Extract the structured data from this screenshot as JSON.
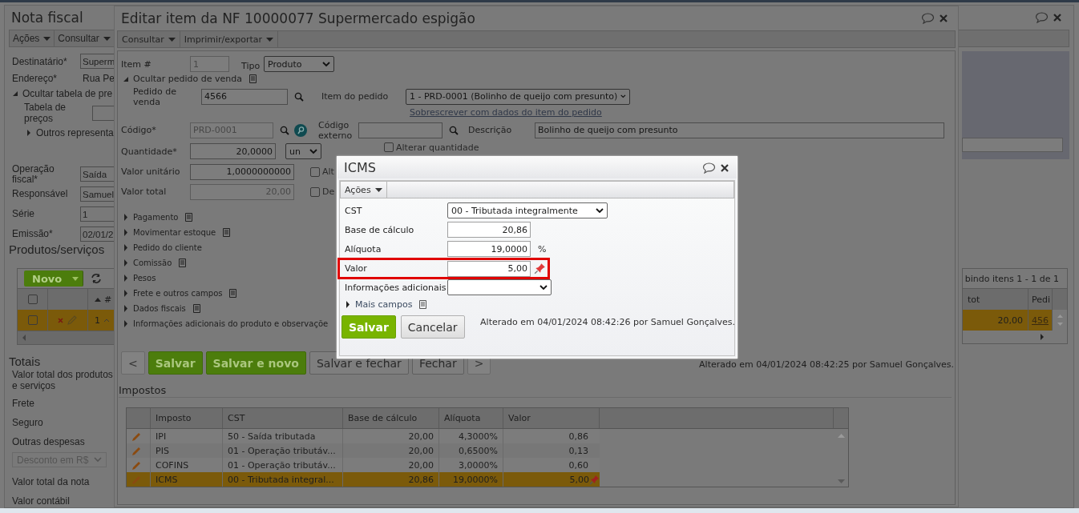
{
  "main_window": {
    "title": "Nota fiscal",
    "toolbar": [
      "Ações",
      "Consultar"
    ],
    "recipient": {
      "label": "Destinatário*",
      "value": "Superm"
    },
    "address": {
      "label": "Endereço*",
      "value": "Rua Pe"
    },
    "price_toggle": {
      "label": "Ocultar tabela de pre",
      "expanded": true
    },
    "price_table": {
      "label": "Tabela de preços"
    },
    "reps_toggle": {
      "label": "Outros representa",
      "expanded": false
    },
    "fields": [
      {
        "label": "Operação fiscal*",
        "value": "Saída"
      },
      {
        "label": "Responsável",
        "value": "Samuel"
      },
      {
        "label": "Série",
        "value": "1"
      },
      {
        "label": "Emissão*",
        "value": "02/01/2"
      }
    ],
    "products": {
      "title": "Produtos/serviços",
      "new_button": "Novo",
      "pager": "bindo itens 1 - 1 de 1",
      "header_checked": false,
      "columns": [
        "#",
        "tot",
        "Pedi"
      ],
      "rows": [
        {
          "number": "1",
          "total": "20,00",
          "order": "456",
          "selected": true,
          "checked": false
        }
      ]
    },
    "totals": {
      "title": "Totais",
      "rows": [
        {
          "kind": "label",
          "text": "Valor total dos produtos e serviços"
        },
        {
          "kind": "label",
          "text": "Frete"
        },
        {
          "kind": "label",
          "text": "Seguro"
        },
        {
          "kind": "label",
          "text": "Outras despesas"
        },
        {
          "kind": "select",
          "text": "Desconto em R$"
        },
        {
          "kind": "label",
          "text": "Valor total da nota"
        },
        {
          "kind": "label",
          "text": "Valor contábil"
        }
      ]
    }
  },
  "item_window": {
    "title": "Editar item da NF 10000077 Supermercado espigão",
    "toolbar": [
      "Consultar",
      "Imprimir/exportar"
    ],
    "item_number": {
      "label": "Item #",
      "value": "1",
      "disabled": true
    },
    "type": {
      "label": "Tipo",
      "value": "Produto"
    },
    "order_toggle": {
      "label": "Ocultar pedido de venda",
      "expanded": true
    },
    "sales_order": {
      "label": "Pedido de venda",
      "value": "4566"
    },
    "order_item": {
      "label": "Item do pedido",
      "value": "1 - PRD-0001 (Bolinho de queijo com presunto)"
    },
    "overwrite_link": "Sobrescrever com dados do item do pedido",
    "code": {
      "label": "Código*",
      "value": "PRD-0001",
      "disabled": true
    },
    "external_code": {
      "label": "Código externo"
    },
    "description": {
      "label": "Descrição",
      "value": "Bolinho de queijo com presunto"
    },
    "quantity": {
      "label": "Quantidade*",
      "value": "20,0000",
      "unit": "un",
      "option": {
        "label": "Alterar quantidade",
        "checked": false
      }
    },
    "unit_price": {
      "label": "Valor unitário",
      "value": "1,0000000000",
      "option": {
        "label": "Alt",
        "checked": false
      }
    },
    "total": {
      "label": "Valor total",
      "value": "20,00",
      "disabled": true,
      "option": {
        "label": "De",
        "checked": false
      }
    },
    "sections": [
      {
        "label": "Pagamento",
        "help": true,
        "expanded": false
      },
      {
        "label": "Movimentar estoque",
        "help": true,
        "expanded": false
      },
      {
        "label": "Pedido do cliente",
        "help": false,
        "expanded": false
      },
      {
        "label": "Comissão",
        "help": true,
        "expanded": false
      },
      {
        "label": "Pesos",
        "help": false,
        "expanded": false
      },
      {
        "label": "Frete e outros campos",
        "help": true,
        "expanded": false
      },
      {
        "label": "Dados fiscais",
        "help": true,
        "expanded": false
      },
      {
        "label": "Informações adicionais do produto e observaçõe",
        "help": false,
        "expanded": false
      }
    ],
    "buttons": [
      {
        "label": "<",
        "kind": "nav",
        "disabled": true
      },
      {
        "label": "Salvar",
        "kind": "primary",
        "disabled": false
      },
      {
        "label": "Salvar e novo",
        "kind": "primary",
        "disabled": false
      },
      {
        "label": "Salvar e fechar",
        "kind": "default",
        "disabled": false
      },
      {
        "label": "Fechar",
        "kind": "default",
        "disabled": false
      },
      {
        "label": ">",
        "kind": "nav",
        "disabled": true
      }
    ],
    "audit": "Alterado em 04/01/2024 08:42:25 por Samuel Gonçalves.",
    "taxes": {
      "title": "Impostos",
      "columns": [
        "Imposto",
        "CST",
        "Base de cálculo",
        "Alíquota",
        "Valor"
      ],
      "rows": [
        {
          "tax": "IPI",
          "cst": "50 - Saída tributada",
          "base": "20,00",
          "rate": "4,3000%",
          "value": "0,86",
          "pinned": false,
          "selected": false
        },
        {
          "tax": "PIS",
          "cst": "01 - Operação tributáv...",
          "base": "20,00",
          "rate": "0,6500%",
          "value": "0,13",
          "pinned": false,
          "selected": false
        },
        {
          "tax": "COFINS",
          "cst": "01 - Operação tributáv...",
          "base": "20,00",
          "rate": "3,0000%",
          "value": "0,60",
          "pinned": false,
          "selected": false
        },
        {
          "tax": "ICMS",
          "cst": "00 - Tributada integral...",
          "base": "20,86",
          "rate": "19,0000%",
          "value": "5,00",
          "pinned": true,
          "selected": true
        }
      ]
    }
  },
  "icms_dialog": {
    "title": "ICMS",
    "toolbar": [
      "Ações"
    ],
    "cst": {
      "label": "CST",
      "value": "00 - Tributada integralmente"
    },
    "base": {
      "label": "Base de cálculo",
      "value": "20,86"
    },
    "rate": {
      "label": "Alíquota",
      "value": "19,0000",
      "unit": "%"
    },
    "amount": {
      "label": "Valor",
      "value": "5,00",
      "highlighted": true,
      "pinned": true
    },
    "additional_info": {
      "label": "Informações adicionais"
    },
    "more_toggle": {
      "label": "Mais campos",
      "expanded": false
    },
    "buttons": [
      {
        "label": "Salvar",
        "kind": "primary"
      },
      {
        "label": "Cancelar",
        "kind": "default"
      }
    ],
    "audit": "Alterado em 04/01/2024 08:42:26 por Samuel Gonçalves."
  }
}
